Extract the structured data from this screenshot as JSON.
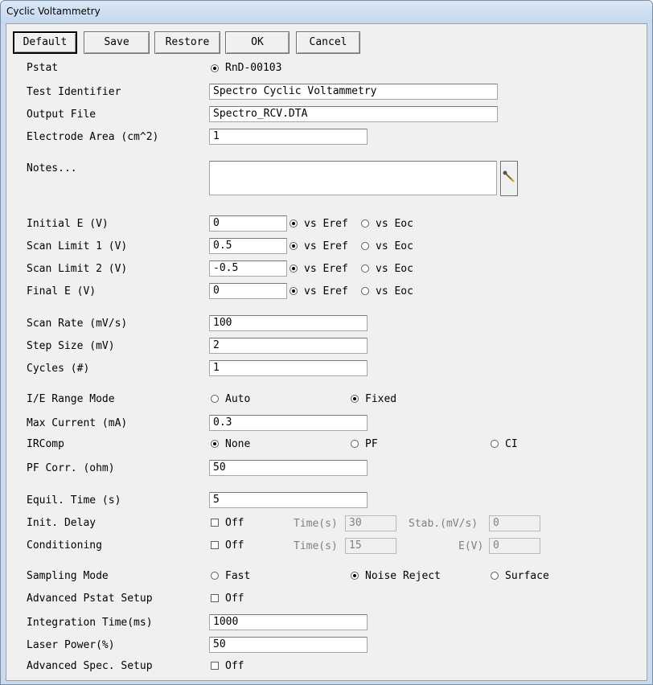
{
  "window": {
    "title": "Cyclic Voltammetry"
  },
  "toolbar": {
    "default_label": "Default",
    "save_label": "Save",
    "restore_label": "Restore",
    "ok_label": "OK",
    "cancel_label": "Cancel"
  },
  "form": {
    "pstat": {
      "label": "Pstat",
      "value": "RnD-00103",
      "selected": true
    },
    "test_identifier": {
      "label": "Test Identifier",
      "value": "Spectro Cyclic Voltammetry"
    },
    "output_file": {
      "label": "Output File",
      "value": "Spectro_RCV.DTA"
    },
    "electrode_area": {
      "label": "Electrode Area (cm^2)",
      "value": "1"
    },
    "notes": {
      "label": "Notes...",
      "value": ""
    },
    "vs_eref_label": "vs Eref",
    "vs_eoc_label": "vs Eoc",
    "initial_e": {
      "label": "Initial E (V)",
      "value": "0",
      "ref": "vs Eref"
    },
    "scan_limit_1": {
      "label": "Scan Limit 1 (V)",
      "value": "0.5",
      "ref": "vs Eref"
    },
    "scan_limit_2": {
      "label": "Scan Limit 2 (V)",
      "value": "-0.5",
      "ref": "vs Eref"
    },
    "final_e": {
      "label": "Final E (V)",
      "value": "0",
      "ref": "vs Eref"
    },
    "scan_rate": {
      "label": "Scan Rate (mV/s)",
      "value": "100"
    },
    "step_size": {
      "label": "Step Size (mV)",
      "value": "2"
    },
    "cycles": {
      "label": "Cycles (#)",
      "value": "1"
    },
    "ie_range_mode": {
      "label": "I/E Range Mode",
      "options": [
        "Auto",
        "Fixed"
      ],
      "selected": "Fixed"
    },
    "max_current": {
      "label": "Max Current (mA)",
      "value": "0.3"
    },
    "ircomp": {
      "label": "IRComp",
      "options": [
        "None",
        "PF",
        "CI"
      ],
      "selected": "None"
    },
    "pf_corr": {
      "label": "PF Corr. (ohm)",
      "value": "50"
    },
    "equil_time": {
      "label": "Equil. Time (s)",
      "value": "5"
    },
    "init_delay": {
      "label": "Init. Delay",
      "check_label": "Off",
      "checked": false,
      "time_label": "Time(s)",
      "time_value": "30",
      "stab_label": "Stab.(mV/s)",
      "stab_value": "0"
    },
    "conditioning": {
      "label": "Conditioning",
      "check_label": "Off",
      "checked": false,
      "time_label": "Time(s)",
      "time_value": "15",
      "e_label": "E(V)",
      "e_value": "0"
    },
    "sampling_mode": {
      "label": "Sampling Mode",
      "options": [
        "Fast",
        "Noise Reject",
        "Surface"
      ],
      "selected": "Noise Reject"
    },
    "advanced_pstat": {
      "label": "Advanced Pstat Setup",
      "check_label": "Off",
      "checked": false
    },
    "integration_time": {
      "label": "Integration Time(ms)",
      "value": "1000"
    },
    "laser_power": {
      "label": "Laser Power(%)",
      "value": "50"
    },
    "advanced_spec": {
      "label": "Advanced Spec. Setup",
      "check_label": "Off",
      "checked": false
    }
  }
}
